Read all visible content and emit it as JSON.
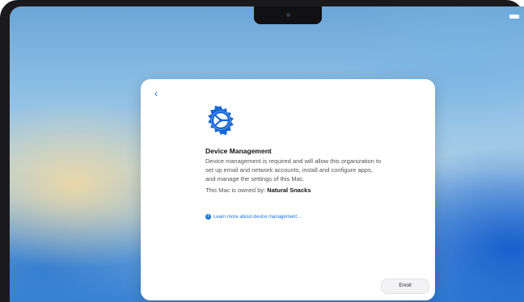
{
  "dialog": {
    "back_icon": "chevron-left-icon",
    "header_icon": "gear-icon",
    "title": "Device Management",
    "description": "Device management is required and will allow this organization to set up email and network accounts, install and configure apps, and manage the settings of this Mac.",
    "owned_prefix": "This Mac is owned by:",
    "owner": "Natural Snacks",
    "learn_more": "Learn more about device management…",
    "enroll_button": "Enroll"
  },
  "colors": {
    "accent": "#1a73e8"
  }
}
